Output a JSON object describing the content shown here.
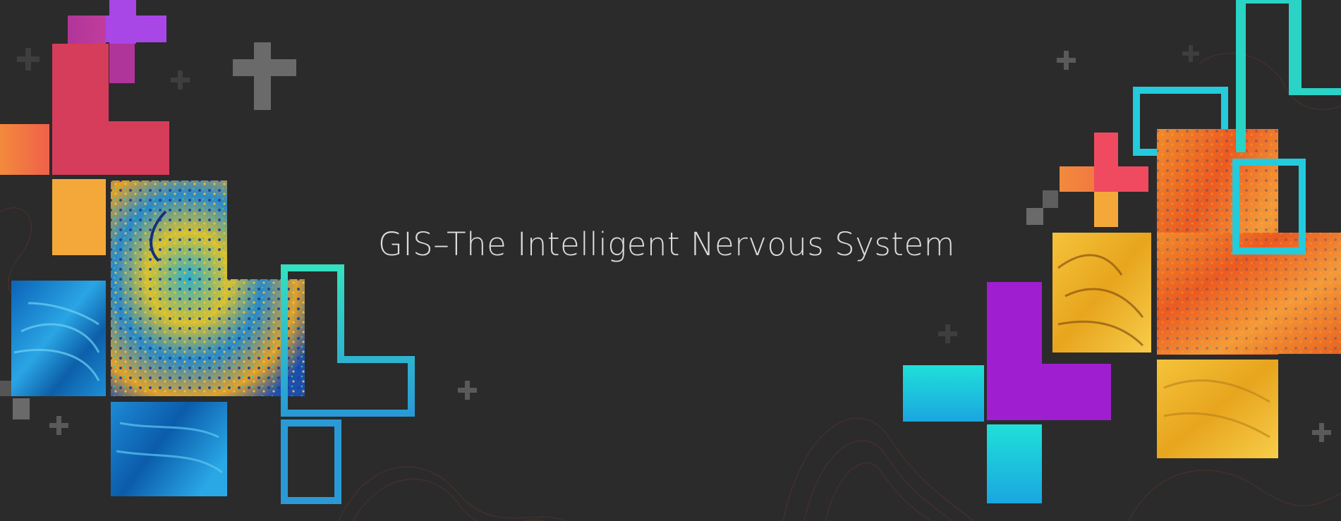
{
  "banner": {
    "headline": "GIS–The Intelligent Nervous System"
  },
  "palette": {
    "background": "#2b2b2b",
    "headline_text": "#dcdcdc",
    "red": "#d63d5b",
    "magenta": "#b0359a",
    "purple": "#a93fe0",
    "orange": "#f08840",
    "amber": "#f5a83a",
    "teal": "#2ad3c5",
    "cyan": "#23cbdc",
    "violet": "#9f1ed0",
    "plus_gray": "#5a5a5a",
    "contour": "#7a3a30"
  }
}
